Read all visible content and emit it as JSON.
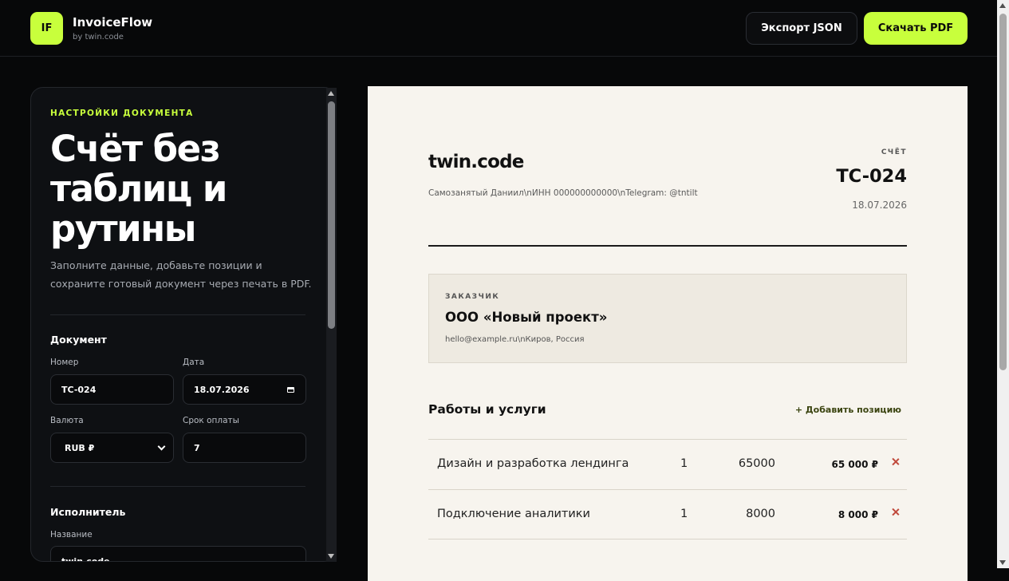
{
  "header": {
    "logo_badge": "IF",
    "app_name": "InvoiceFlow",
    "app_sub": "by twin.code",
    "export_label": "Экспорт JSON",
    "pdf_label": "Скачать PDF"
  },
  "colors": {
    "accent": "#c8ff3c",
    "background": "#070809",
    "paper": "#f7f4ee",
    "danger": "#c0483a"
  },
  "settings": {
    "eyebrow": "НАСТРОЙКИ ДОКУМЕНТА",
    "hero_title": "Счёт без таблиц и рутины",
    "description": "Заполните данные, добавьте позиции и сохраните готовый документ через печать в PDF.",
    "document": {
      "heading": "Документ",
      "number_label": "Номер",
      "number_value": "TC-024",
      "date_label": "Дата",
      "date_value": "18.07.2026",
      "currency_label": "Валюта",
      "currency_value": "RUB ₽",
      "term_label": "Срок оплаты",
      "term_value": "7"
    },
    "executor": {
      "heading": "Исполнитель",
      "name_label": "Название",
      "name_value": "twin.code"
    }
  },
  "invoice": {
    "brand": "twin.code",
    "issuer_details": "Самозанятый Даниил\\nИНН 000000000000\\nTelegram: @tntilt",
    "doc_label": "СЧЁТ",
    "doc_number": "TC-024",
    "doc_date": "18.07.2026",
    "client": {
      "label": "ЗАКАЗЧИК",
      "name": "ООО «Новый проект»",
      "contact": "hello@example.ru\\nКиров, Россия"
    },
    "works_title": "Работы и услуги",
    "add_position": "+ Добавить позицию",
    "items": [
      {
        "name": "Дизайн и разработка лендинга",
        "qty": "1",
        "price": "65000",
        "total": "65 000 ₽"
      },
      {
        "name": "Подключение аналитики",
        "qty": "1",
        "price": "8000",
        "total": "8 000 ₽"
      }
    ]
  }
}
